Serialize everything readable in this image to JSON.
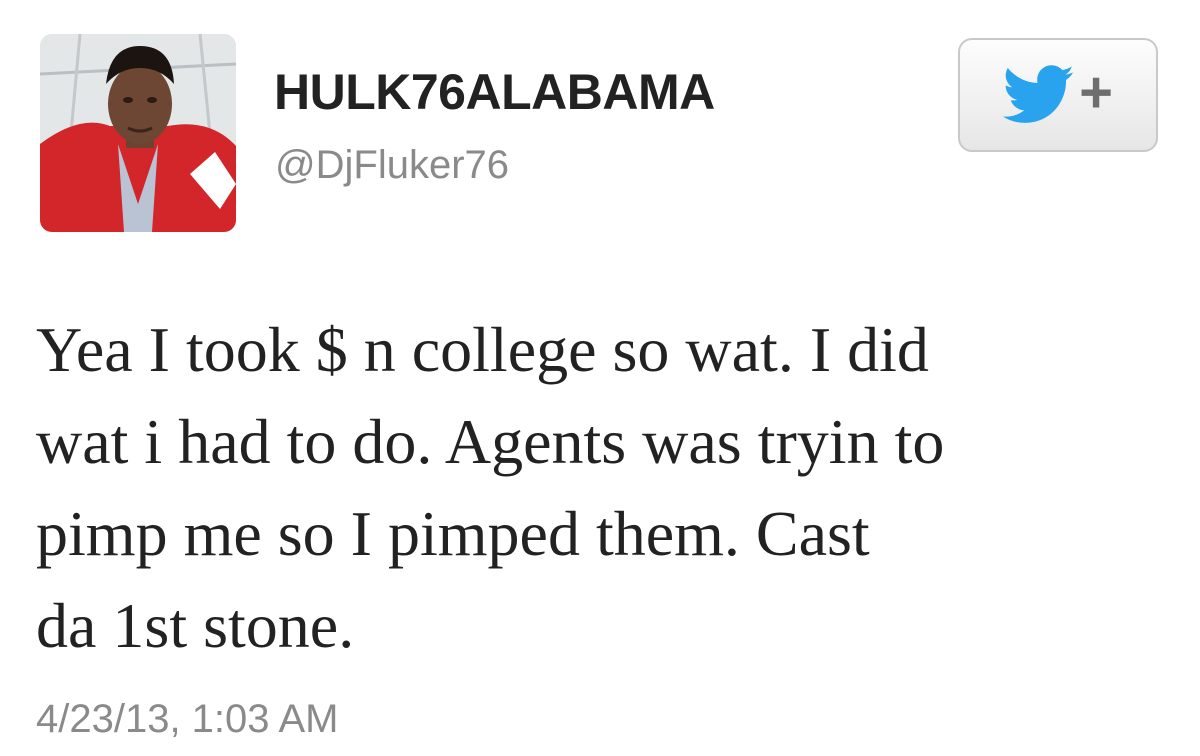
{
  "tweet": {
    "display_name": "HULK76ALABAMA",
    "handle": "@DjFluker76",
    "text": "Yea I took $ n college so wat. I did\nwat i had to do. Agents was tryin to\npimp me so I pimped them. Cast\nda 1st stone.",
    "timestamp": "4/23/13, 1:03 AM"
  },
  "follow_button": {
    "icon": "twitter-bird-icon",
    "symbol": "+"
  },
  "colors": {
    "text": "#222222",
    "secondary_text": "#8a8a8a",
    "twitter_blue": "#2aa3ef",
    "jacket_red": "#d3262b"
  }
}
